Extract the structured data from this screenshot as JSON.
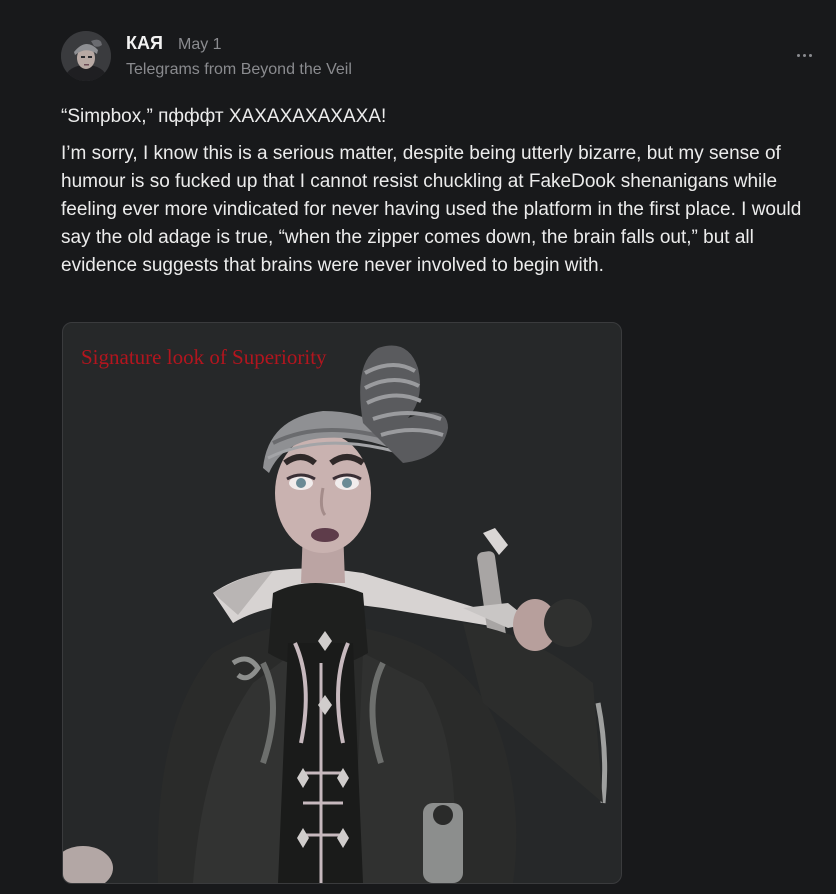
{
  "post": {
    "author": "КАЯ",
    "date": "May 1",
    "publication": "Telegrams from Beyond the Veil",
    "paragraphs": [
      "“Simpbox,” пфффт ХАХАХАХАХАХА!",
      "I’m sorry, I know this is a serious matter, despite being utterly bizarre, but my sense of humour is so fucked up that I cannot resist chuckling at FakeDook shenanigans while feeling ever more vindicated for never having used the platform in the first place. I would say the old adage is true, “when the zipper comes down, the brain falls out,” but all evidence suggests that brains were never involved to begin with."
    ],
    "image": {
      "caption": "Signature look of Superiority"
    },
    "more_icon": "ellipsis-icon"
  },
  "colors": {
    "background": "#18191b",
    "text": "#ececec",
    "muted": "#8a8b8f",
    "caption": "#b3151e",
    "image_bg": "#262829"
  }
}
